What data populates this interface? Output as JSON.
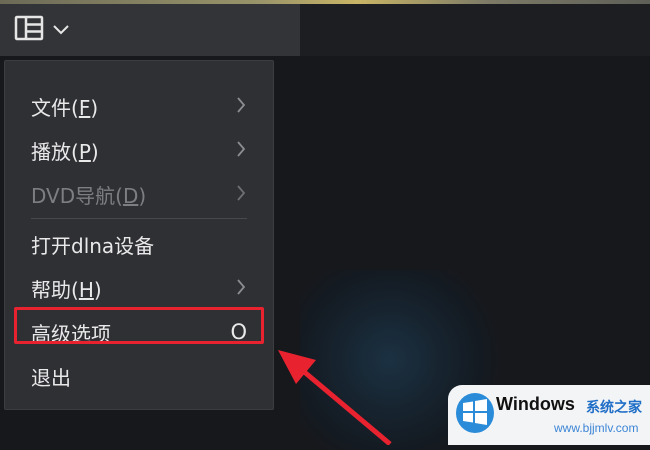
{
  "menu": {
    "items": [
      {
        "label": "文件(",
        "mnemonic": "F",
        "suffix": ")",
        "has_submenu": true,
        "disabled": false
      },
      {
        "label": "播放(",
        "mnemonic": "P",
        "suffix": ")",
        "has_submenu": true,
        "disabled": false
      },
      {
        "label": "DVD导航(",
        "mnemonic": "D",
        "suffix": ")",
        "has_submenu": true,
        "disabled": true
      },
      {
        "label": "打开dlna设备",
        "mnemonic": "",
        "suffix": "",
        "has_submenu": false,
        "disabled": false
      },
      {
        "label": "帮助(",
        "mnemonic": "H",
        "suffix": ")",
        "has_submenu": true,
        "disabled": false
      },
      {
        "label": "高级选项",
        "mnemonic": "",
        "suffix": "",
        "shortcut": "O",
        "has_submenu": false,
        "disabled": false
      },
      {
        "label": "退出",
        "mnemonic": "",
        "suffix": "",
        "has_submenu": false,
        "disabled": false
      }
    ]
  },
  "toolbar": {
    "menu_icon": "layout-icon",
    "dropdown_icon": "chevron-down-icon"
  },
  "annotation": {
    "highlight_color": "#e8232f",
    "arrow_color": "#e8232f"
  },
  "watermark": {
    "title": "Windows",
    "site_cn": "系统之家",
    "site_url": "www.bjjmlv.com"
  }
}
